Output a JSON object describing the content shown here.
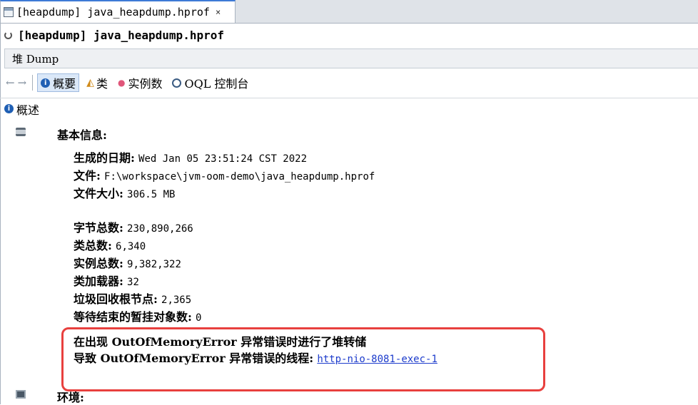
{
  "tab": {
    "label": "[heapdump] java_heapdump.hprof",
    "close": "×"
  },
  "title": "[heapdump] java_heapdump.hprof",
  "subtab": "堆 Dump",
  "toolbar": {
    "back": "←",
    "forward": "→",
    "summary": "概要",
    "classes": "类",
    "instances": "实例数",
    "oql": "OQL 控制台",
    "info_glyph": "i"
  },
  "section": {
    "title": "概述"
  },
  "basic_info": {
    "heading": "基本信息:",
    "date_label": "生成的日期:",
    "date_value": "Wed Jan 05 23:51:24 CST 2022",
    "file_label": "文件:",
    "file_value": "F:\\workspace\\jvm-oom-demo\\java_heapdump.hprof",
    "size_label": "文件大小:",
    "size_value": "306.5 MB",
    "bytes_label": "字节总数:",
    "bytes_value": "230,890,266",
    "classes_label": "类总数:",
    "classes_value": "6,340",
    "instances_label": "实例总数:",
    "instances_value": "9,382,322",
    "loaders_label": "类加载器:",
    "loaders_value": "32",
    "gcroots_label": "垃圾回收根节点:",
    "gcroots_value": "2,365",
    "pending_label": "等待结束的暂挂对象数:",
    "pending_value": "0"
  },
  "oom": {
    "line1": "在出现 OutOfMemoryError 异常错误时进行了堆转储",
    "line2_label": "导致 OutOfMemoryError 异常错误的线程:",
    "thread_link": "http-nio-8081-exec-1"
  },
  "environment": {
    "heading": "环境:"
  },
  "colors": {
    "highlight": "#e8403e",
    "link": "#1d3ccc",
    "accent": "#3d7ad6"
  }
}
